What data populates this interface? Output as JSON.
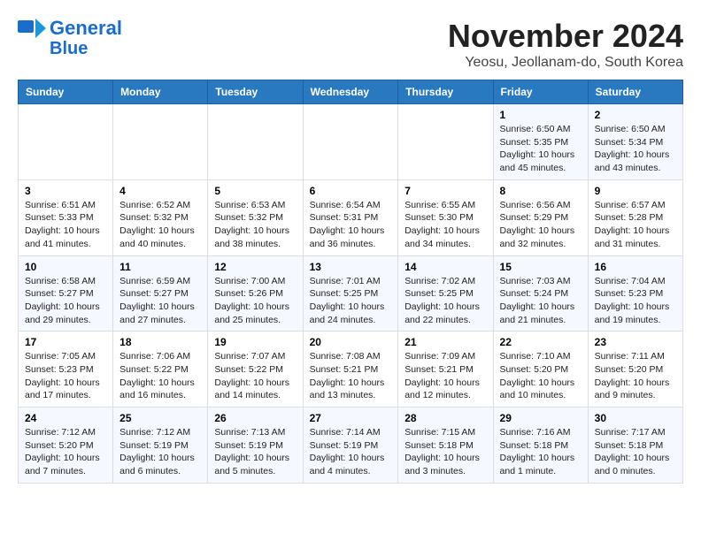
{
  "header": {
    "logo_line1": "General",
    "logo_line2": "Blue",
    "title": "November 2024",
    "subtitle": "Yeosu, Jeollanam-do, South Korea"
  },
  "weekdays": [
    "Sunday",
    "Monday",
    "Tuesday",
    "Wednesday",
    "Thursday",
    "Friday",
    "Saturday"
  ],
  "weeks": [
    [
      {
        "day": "",
        "info": ""
      },
      {
        "day": "",
        "info": ""
      },
      {
        "day": "",
        "info": ""
      },
      {
        "day": "",
        "info": ""
      },
      {
        "day": "",
        "info": ""
      },
      {
        "day": "1",
        "info": "Sunrise: 6:50 AM\nSunset: 5:35 PM\nDaylight: 10 hours\nand 45 minutes."
      },
      {
        "day": "2",
        "info": "Sunrise: 6:50 AM\nSunset: 5:34 PM\nDaylight: 10 hours\nand 43 minutes."
      }
    ],
    [
      {
        "day": "3",
        "info": "Sunrise: 6:51 AM\nSunset: 5:33 PM\nDaylight: 10 hours\nand 41 minutes."
      },
      {
        "day": "4",
        "info": "Sunrise: 6:52 AM\nSunset: 5:32 PM\nDaylight: 10 hours\nand 40 minutes."
      },
      {
        "day": "5",
        "info": "Sunrise: 6:53 AM\nSunset: 5:32 PM\nDaylight: 10 hours\nand 38 minutes."
      },
      {
        "day": "6",
        "info": "Sunrise: 6:54 AM\nSunset: 5:31 PM\nDaylight: 10 hours\nand 36 minutes."
      },
      {
        "day": "7",
        "info": "Sunrise: 6:55 AM\nSunset: 5:30 PM\nDaylight: 10 hours\nand 34 minutes."
      },
      {
        "day": "8",
        "info": "Sunrise: 6:56 AM\nSunset: 5:29 PM\nDaylight: 10 hours\nand 32 minutes."
      },
      {
        "day": "9",
        "info": "Sunrise: 6:57 AM\nSunset: 5:28 PM\nDaylight: 10 hours\nand 31 minutes."
      }
    ],
    [
      {
        "day": "10",
        "info": "Sunrise: 6:58 AM\nSunset: 5:27 PM\nDaylight: 10 hours\nand 29 minutes."
      },
      {
        "day": "11",
        "info": "Sunrise: 6:59 AM\nSunset: 5:27 PM\nDaylight: 10 hours\nand 27 minutes."
      },
      {
        "day": "12",
        "info": "Sunrise: 7:00 AM\nSunset: 5:26 PM\nDaylight: 10 hours\nand 25 minutes."
      },
      {
        "day": "13",
        "info": "Sunrise: 7:01 AM\nSunset: 5:25 PM\nDaylight: 10 hours\nand 24 minutes."
      },
      {
        "day": "14",
        "info": "Sunrise: 7:02 AM\nSunset: 5:25 PM\nDaylight: 10 hours\nand 22 minutes."
      },
      {
        "day": "15",
        "info": "Sunrise: 7:03 AM\nSunset: 5:24 PM\nDaylight: 10 hours\nand 21 minutes."
      },
      {
        "day": "16",
        "info": "Sunrise: 7:04 AM\nSunset: 5:23 PM\nDaylight: 10 hours\nand 19 minutes."
      }
    ],
    [
      {
        "day": "17",
        "info": "Sunrise: 7:05 AM\nSunset: 5:23 PM\nDaylight: 10 hours\nand 17 minutes."
      },
      {
        "day": "18",
        "info": "Sunrise: 7:06 AM\nSunset: 5:22 PM\nDaylight: 10 hours\nand 16 minutes."
      },
      {
        "day": "19",
        "info": "Sunrise: 7:07 AM\nSunset: 5:22 PM\nDaylight: 10 hours\nand 14 minutes."
      },
      {
        "day": "20",
        "info": "Sunrise: 7:08 AM\nSunset: 5:21 PM\nDaylight: 10 hours\nand 13 minutes."
      },
      {
        "day": "21",
        "info": "Sunrise: 7:09 AM\nSunset: 5:21 PM\nDaylight: 10 hours\nand 12 minutes."
      },
      {
        "day": "22",
        "info": "Sunrise: 7:10 AM\nSunset: 5:20 PM\nDaylight: 10 hours\nand 10 minutes."
      },
      {
        "day": "23",
        "info": "Sunrise: 7:11 AM\nSunset: 5:20 PM\nDaylight: 10 hours\nand 9 minutes."
      }
    ],
    [
      {
        "day": "24",
        "info": "Sunrise: 7:12 AM\nSunset: 5:20 PM\nDaylight: 10 hours\nand 7 minutes."
      },
      {
        "day": "25",
        "info": "Sunrise: 7:12 AM\nSunset: 5:19 PM\nDaylight: 10 hours\nand 6 minutes."
      },
      {
        "day": "26",
        "info": "Sunrise: 7:13 AM\nSunset: 5:19 PM\nDaylight: 10 hours\nand 5 minutes."
      },
      {
        "day": "27",
        "info": "Sunrise: 7:14 AM\nSunset: 5:19 PM\nDaylight: 10 hours\nand 4 minutes."
      },
      {
        "day": "28",
        "info": "Sunrise: 7:15 AM\nSunset: 5:18 PM\nDaylight: 10 hours\nand 3 minutes."
      },
      {
        "day": "29",
        "info": "Sunrise: 7:16 AM\nSunset: 5:18 PM\nDaylight: 10 hours\nand 1 minute."
      },
      {
        "day": "30",
        "info": "Sunrise: 7:17 AM\nSunset: 5:18 PM\nDaylight: 10 hours\nand 0 minutes."
      }
    ]
  ]
}
